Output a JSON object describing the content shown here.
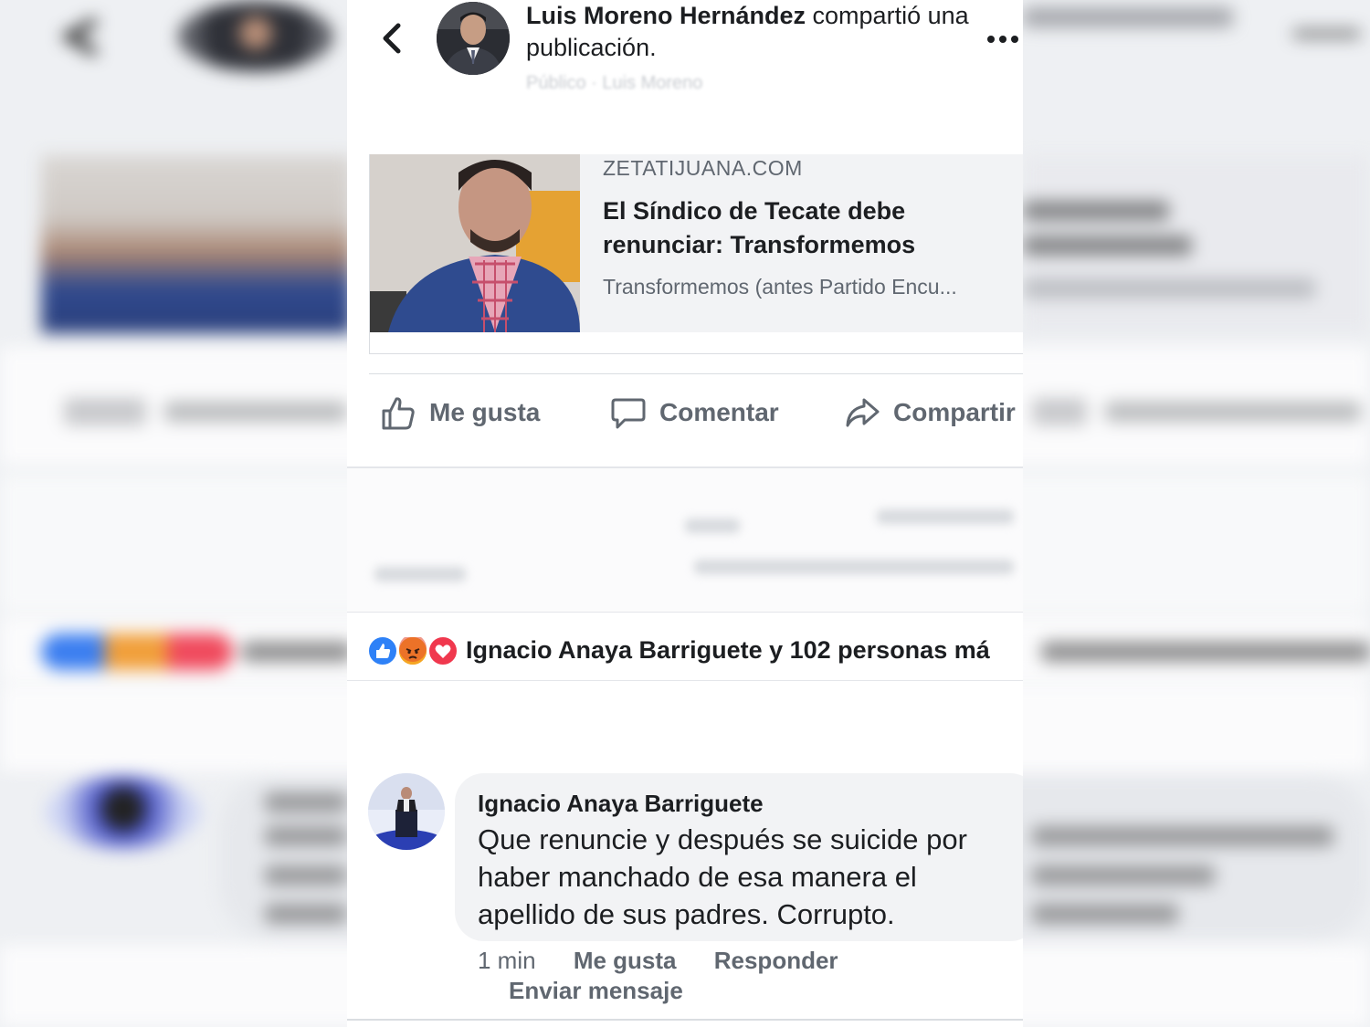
{
  "post": {
    "author": "Luis Moreno Hernández",
    "action_text": " compartió una publicación.",
    "sub_text": "Público · Luis Moreno"
  },
  "link_card": {
    "domain": "ZETATIJUANA.COM",
    "title": "El Síndico de Tecate debe renunciar: Transformemos",
    "description": "Transformemos (antes Partido Encu..."
  },
  "actions": {
    "like": "Me gusta",
    "comment": "Comentar",
    "share": "Compartir"
  },
  "reactions": {
    "summary": "Ignacio Anaya Barriguete y 102 personas má",
    "icons": [
      "like-icon",
      "angry-icon",
      "love-icon"
    ],
    "colors": {
      "like": "#2e81f7",
      "angry": "#f5a623",
      "love": "#f0384e"
    }
  },
  "comment": {
    "author": "Ignacio Anaya Barriguete",
    "text": "Que renuncie y después se suicide por haber manchado de esa manera el apellido de sus padres. Corrupto.",
    "time": "1 min",
    "like": "Me gusta",
    "reply": "Responder",
    "message": "Enviar mensaje"
  },
  "colors": {
    "text_primary": "#1c1e21",
    "text_secondary": "#606770",
    "card_bg": "#f2f3f5",
    "divider": "#dadde1"
  }
}
